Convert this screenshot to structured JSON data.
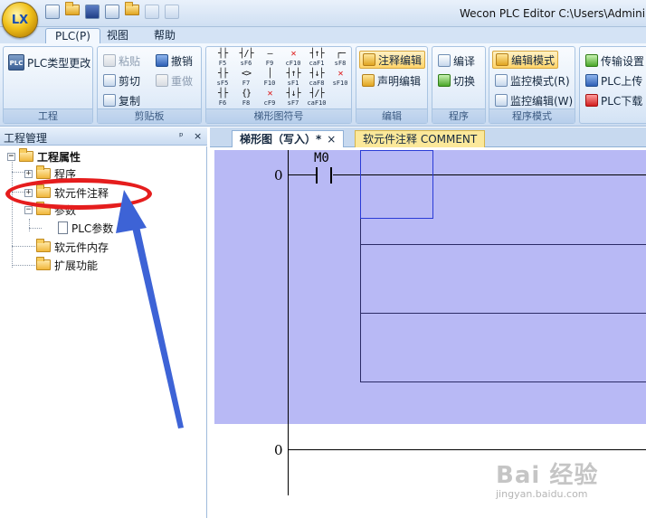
{
  "titlebar": {
    "title": "Wecon PLC Editor  C:\\Users\\Admini",
    "logo_text": "LX",
    "quick_access": [
      "new-file-icon",
      "open-folder-icon",
      "save-icon",
      "print-icon",
      "folder-icon",
      "redo-icon",
      "dropdown-icon"
    ]
  },
  "ribbon_tabs": [
    {
      "label": "PLC(P)",
      "active": true
    },
    {
      "label": "视图",
      "active": false
    },
    {
      "label": "帮助",
      "active": false
    }
  ],
  "ribbon": {
    "project": {
      "label": "工程",
      "change_plc_type": "PLC类型更改"
    },
    "clipboard": {
      "label": "剪贴板",
      "paste": "粘贴",
      "cut": "剪切",
      "copy": "复制",
      "undo": "撤销",
      "redo": "重做"
    },
    "ladder_symbols": {
      "label": "梯形图符号",
      "symbols": [
        {
          "sym": "┤├",
          "key": "F5"
        },
        {
          "sym": "┤/├",
          "key": "sF6"
        },
        {
          "sym": "—",
          "key": "F9"
        },
        {
          "sym": "✕",
          "key": "cF10",
          "red": true
        },
        {
          "sym": "┤↑├",
          "key": "caF1"
        },
        {
          "sym": "┌─",
          "key": "sF8"
        },
        {
          "sym": "┤├",
          "key": "sF5"
        },
        {
          "sym": "<>",
          "key": "F7"
        },
        {
          "sym": "│",
          "key": "F10"
        },
        {
          "sym": "┤↑├",
          "key": "sF1"
        },
        {
          "sym": "┤↓├",
          "key": "caF8"
        },
        {
          "sym": "✕",
          "key": "sF10",
          "red": true
        },
        {
          "sym": "┤├",
          "key": "F6"
        },
        {
          "sym": "{}",
          "key": "F8"
        },
        {
          "sym": "✕",
          "key": "cF9",
          "red": true
        },
        {
          "sym": "┤↓├",
          "key": "sF7"
        },
        {
          "sym": "┤/├",
          "key": "caF10"
        },
        {
          "sym": "",
          "key": ""
        }
      ]
    },
    "edit": {
      "label": "编辑",
      "comment_edit": "注释编辑",
      "statement_edit": "声明编辑"
    },
    "program": {
      "label": "程序",
      "compile": "编译",
      "switch": "切换"
    },
    "program_mode": {
      "label": "程序模式",
      "edit_mode": "编辑模式",
      "monitor_mode": "监控模式(R)",
      "monitor_edit": "监控编辑(W)"
    },
    "transfer": {
      "settings": "传输设置",
      "upload": "PLC上传",
      "download": "PLC下载"
    }
  },
  "project_panel": {
    "title": "工程管理",
    "pin": "ᵖ",
    "close": "×",
    "tree": [
      {
        "label": "工程属性",
        "level": 0,
        "expander": "−",
        "bold": true
      },
      {
        "label": "程序",
        "level": 1,
        "expander": "+"
      },
      {
        "label": "软元件注释",
        "level": 1,
        "expander": "+"
      },
      {
        "label": "参数",
        "level": 1,
        "expander": "−"
      },
      {
        "label": "PLC参数",
        "level": 2,
        "doc": true
      },
      {
        "label": "软元件内存",
        "level": 1
      },
      {
        "label": "扩展功能",
        "level": 1
      }
    ]
  },
  "editor": {
    "tabs": [
      {
        "label": "梯形图（写入）*",
        "close": "×"
      },
      {
        "label": "软元件注释 COMMENT"
      }
    ],
    "steps": [
      "0",
      "0"
    ],
    "contact": "M0"
  },
  "watermark": {
    "main": "Bai 经验",
    "sub": "jingyan.baidu.com"
  },
  "colors": {
    "ladder_bg": "#b8b9f5",
    "annotation": "#e51d1d",
    "arrow": "#3d63d6",
    "cursor": "#2a3bd6"
  }
}
